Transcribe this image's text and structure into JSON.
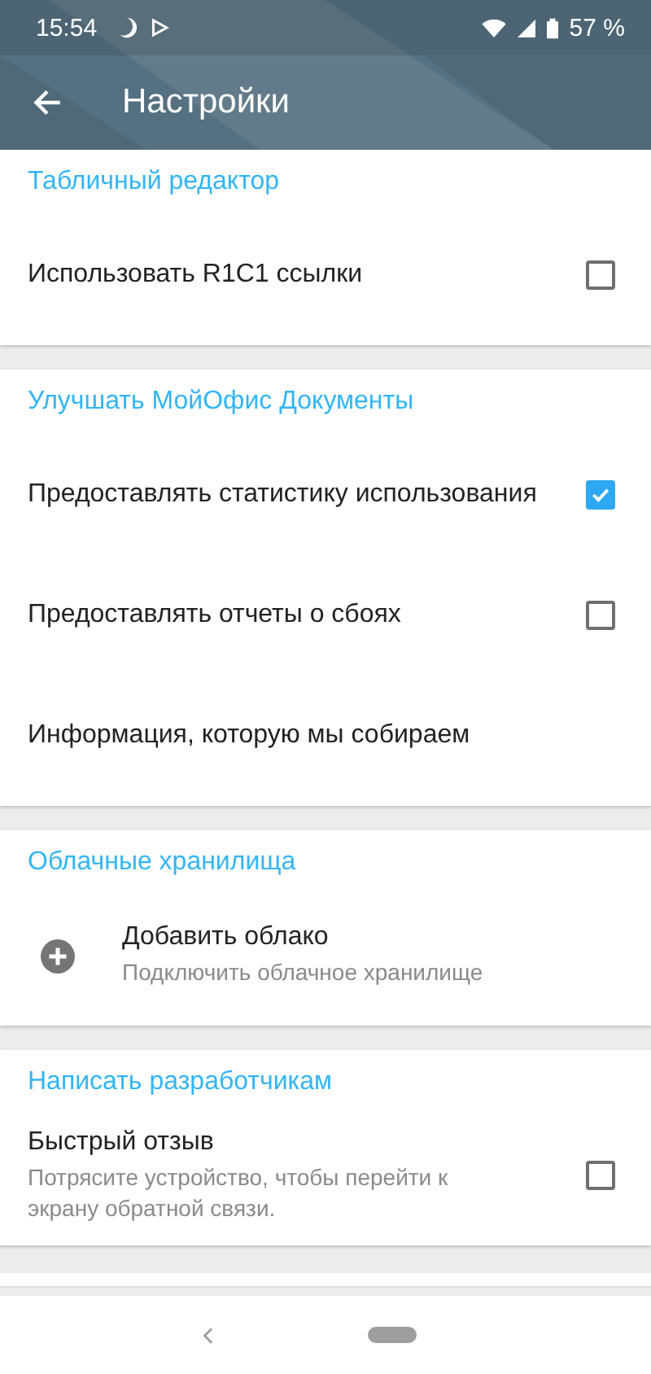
{
  "status_bar": {
    "time": "15:54",
    "battery": "57 %"
  },
  "app_bar": {
    "title": "Настройки"
  },
  "sections": [
    {
      "header": "Табличный редактор",
      "items": [
        {
          "kind": "checkbox",
          "label": "Использовать R1C1 ссылки",
          "checked": false
        }
      ]
    },
    {
      "header": "Улучшать МойОфис Документы",
      "items": [
        {
          "kind": "checkbox",
          "label": "Предоставлять статистику использования",
          "checked": true
        },
        {
          "kind": "checkbox",
          "label": "Предоставлять отчеты о сбоях",
          "checked": false
        },
        {
          "kind": "link",
          "label": "Информация, которую мы собираем"
        }
      ]
    },
    {
      "header": "Облачные хранилища",
      "items": [
        {
          "kind": "action",
          "label": "Добавить облако",
          "summary": "Подключить облачное хранилище"
        }
      ]
    },
    {
      "header": "Написать разработчикам",
      "items": [
        {
          "kind": "checkbox",
          "label": "Быстрый отзыв",
          "summary": "Потрясите устройство, чтобы перейти к экрану обратной связи.",
          "checked": false
        }
      ]
    }
  ]
}
